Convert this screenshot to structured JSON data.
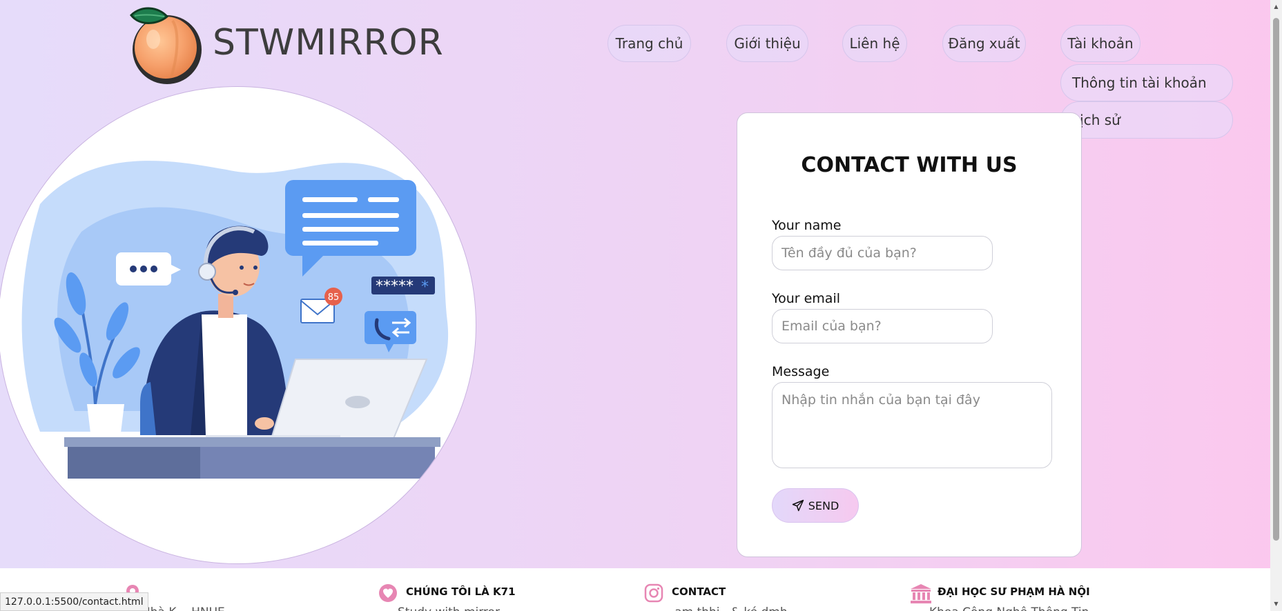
{
  "brand": {
    "name": "STWMIRROR",
    "logo_icon": "peach-icon"
  },
  "nav": {
    "items": [
      {
        "label": "Trang chủ"
      },
      {
        "label": "Giới thiệu"
      },
      {
        "label": "Liên hệ"
      },
      {
        "label": "Đăng xuất"
      },
      {
        "label": "Tài khoản"
      }
    ],
    "account_dropdown": [
      {
        "label": "Thông tin tài khoản"
      },
      {
        "label": "Lịch sử"
      }
    ]
  },
  "hero": {
    "illustration": "customer-support-agent-illustration",
    "badge_count": "85",
    "password_mask": "*****"
  },
  "contact": {
    "title": "CONTACT WITH US",
    "name_label": "Your name",
    "name_placeholder": "Tên đầy đủ của bạn?",
    "email_label": "Your email",
    "email_placeholder": "Email của bạn?",
    "message_label": "Message",
    "message_placeholder": "Nhập tin nhắn của bạn tại đây",
    "send_label": "SEND",
    "send_icon": "paper-plane-icon"
  },
  "footer": {
    "columns": [
      {
        "title": "",
        "subtitle": "Nhà K... HNUE",
        "icon": "pin-icon"
      },
      {
        "title": "CHÚNG TÔI LÀ K71",
        "subtitle": "Study with mirror",
        "icon": "heart-icon"
      },
      {
        "title": "CONTACT",
        "subtitle": "...am.thhi...& ké.dmh",
        "icon": "instagram-icon"
      },
      {
        "title": "ĐẠI HỌC SƯ PHẠM HÀ NỘI",
        "subtitle": "Khoa Công Nghệ Thông Tin",
        "icon": "university-icon"
      }
    ]
  },
  "status_bar": {
    "url": "127.0.0.1:5500/contact.html"
  },
  "colors": {
    "background_start": "#e6dcfa",
    "background_end": "#fbc8ee",
    "accent_blue": "#5b9bf2",
    "navy": "#253a78",
    "footer_icon_pink": "#e786b3"
  }
}
